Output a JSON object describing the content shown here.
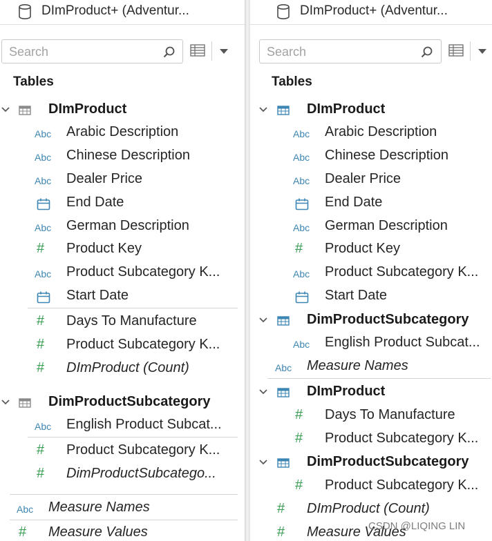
{
  "left": {
    "title": "DImProduct+ (Adventur...",
    "search_placeholder": "Search",
    "section": "Tables",
    "tree": [
      {
        "kind": "table",
        "label": "DImProduct"
      },
      {
        "kind": "abc",
        "label": "Arabic Description"
      },
      {
        "kind": "abc",
        "label": "Chinese Description"
      },
      {
        "kind": "abc",
        "label": "Dealer Price"
      },
      {
        "kind": "date",
        "label": "End Date"
      },
      {
        "kind": "abc",
        "label": "German Description"
      },
      {
        "kind": "num",
        "label": "Product Key"
      },
      {
        "kind": "abc",
        "label": "Product Subcategory K..."
      },
      {
        "kind": "date",
        "label": "Start Date"
      },
      {
        "kind": "num",
        "label": "Days To Manufacture"
      },
      {
        "kind": "num",
        "label": "Product Subcategory K..."
      },
      {
        "kind": "num",
        "label": "DImProduct (Count)",
        "italic": true
      },
      {
        "kind": "table",
        "label": "DimProductSubcategory"
      },
      {
        "kind": "abc",
        "label": "English Product Subcat..."
      },
      {
        "kind": "num",
        "label": "Product Subcategory K..."
      },
      {
        "kind": "num",
        "label": "DimProductSubcatego...",
        "italic": true
      },
      {
        "kind": "abc",
        "label": "Measure Names",
        "italic": true
      },
      {
        "kind": "num",
        "label": "Measure Values",
        "italic": true
      }
    ]
  },
  "right": {
    "title": "DImProduct+ (Adventur...",
    "search_placeholder": "Search",
    "section": "Tables",
    "tree": [
      {
        "kind": "table",
        "label": "DImProduct"
      },
      {
        "kind": "abc",
        "label": "Arabic Description"
      },
      {
        "kind": "abc",
        "label": "Chinese Description"
      },
      {
        "kind": "abc",
        "label": "Dealer Price"
      },
      {
        "kind": "date",
        "label": "End Date"
      },
      {
        "kind": "abc",
        "label": "German Description"
      },
      {
        "kind": "num",
        "label": "Product Key"
      },
      {
        "kind": "abc",
        "label": "Product Subcategory K..."
      },
      {
        "kind": "date",
        "label": "Start Date"
      },
      {
        "kind": "table",
        "label": "DimProductSubcategory"
      },
      {
        "kind": "abc",
        "label": "English Product Subcat..."
      },
      {
        "kind": "abc",
        "label": "Measure Names",
        "italic": true
      },
      {
        "kind": "table",
        "label": "DImProduct"
      },
      {
        "kind": "num",
        "label": "Days To Manufacture"
      },
      {
        "kind": "num",
        "label": "Product Subcategory K..."
      },
      {
        "kind": "table",
        "label": "DimProductSubcategory"
      },
      {
        "kind": "num",
        "label": "Product Subcategory K..."
      },
      {
        "kind": "num",
        "label": "DImProduct (Count)",
        "italic": true
      },
      {
        "kind": "num",
        "label": "Measure Values",
        "italic": true
      }
    ]
  },
  "icons": {
    "abc": "Abc",
    "num": "#"
  },
  "colors": {
    "abc_icon": "#3d86b3",
    "num_icon": "#3b9e55",
    "left_table_icon": "#8a8a8a",
    "right_table_icon": "#3d86b3"
  },
  "watermark": "CSDN @LIQING LIN"
}
